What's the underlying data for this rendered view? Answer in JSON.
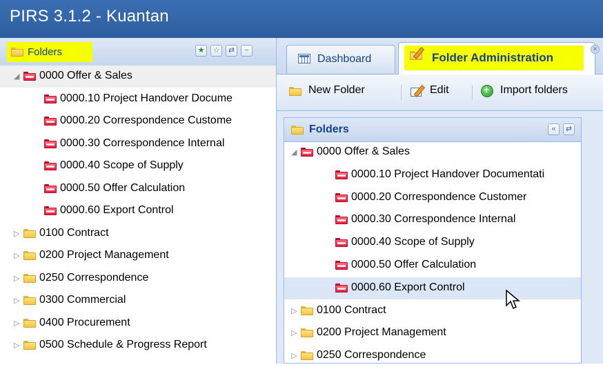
{
  "window": {
    "title": "PIRS 3.1.2  -  Kuantan"
  },
  "left_panel": {
    "header": "Folders",
    "tree": [
      {
        "label": "0000 Offer & Sales",
        "level": 0,
        "expanded": true,
        "color": "red"
      },
      {
        "label": "0000.10 Project Handover Docume",
        "level": 1,
        "color": "red"
      },
      {
        "label": "0000.20 Correspondence Custome",
        "level": 1,
        "color": "red"
      },
      {
        "label": "0000.30 Correspondence Internal",
        "level": 1,
        "color": "red"
      },
      {
        "label": "0000.40 Scope of Supply",
        "level": 1,
        "color": "red"
      },
      {
        "label": "0000.50 Offer Calculation",
        "level": 1,
        "color": "red"
      },
      {
        "label": "0000.60 Export Control",
        "level": 1,
        "color": "red"
      },
      {
        "label": "0100 Contract",
        "level": 0,
        "expanded": false,
        "color": "yellow"
      },
      {
        "label": "0200 Project Management",
        "level": 0,
        "expanded": false,
        "color": "yellow"
      },
      {
        "label": "0250 Correspondence",
        "level": 0,
        "expanded": false,
        "color": "yellow"
      },
      {
        "label": "0300 Commercial",
        "level": 0,
        "expanded": false,
        "color": "yellow"
      },
      {
        "label": "0400 Procurement",
        "level": 0,
        "expanded": false,
        "color": "yellow"
      },
      {
        "label": "0500 Schedule & Progress Report",
        "level": 0,
        "expanded": false,
        "color": "yellow"
      }
    ]
  },
  "tabs": [
    {
      "label": "Dashboard",
      "icon": "dashboard-icon"
    },
    {
      "label": "Folder Administration",
      "icon": "folder-edit-icon",
      "active": true
    }
  ],
  "toolbar": {
    "new_folder": "New Folder",
    "edit": "Edit",
    "import_folders": "Import folders"
  },
  "folders_panel": {
    "header": "Folders",
    "tree": [
      {
        "label": "0000 Offer & Sales",
        "level": 0,
        "expanded": true,
        "color": "red"
      },
      {
        "label": "0000.10 Project Handover Documentati",
        "level": 1,
        "color": "red"
      },
      {
        "label": "0000.20 Correspondence Customer",
        "level": 1,
        "color": "red"
      },
      {
        "label": "0000.30 Correspondence Internal",
        "level": 1,
        "color": "red"
      },
      {
        "label": "0000.40 Scope of Supply",
        "level": 1,
        "color": "red"
      },
      {
        "label": "0000.50 Offer Calculation",
        "level": 1,
        "color": "red"
      },
      {
        "label": "0000.60 Export Control",
        "level": 1,
        "color": "red",
        "selected": true
      },
      {
        "label": "0100 Contract",
        "level": 0,
        "expanded": false,
        "color": "yellow"
      },
      {
        "label": "0200 Project Management",
        "level": 0,
        "expanded": false,
        "color": "yellow"
      },
      {
        "label": "0250 Correspondence",
        "level": 0,
        "expanded": false,
        "color": "yellow"
      }
    ]
  },
  "colors": {
    "titlebar": "#2d5d9e",
    "highlight": "#f5ff00",
    "header_text": "#15428b"
  }
}
